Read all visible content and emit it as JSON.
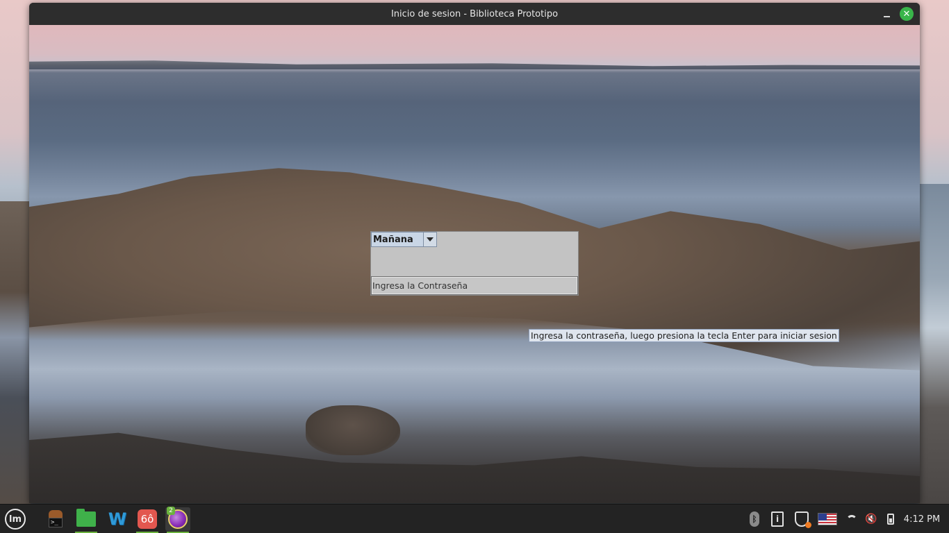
{
  "window": {
    "title": "Inicio de sesion - Biblioteca Prototipo",
    "minimize_symbol": "–",
    "close_symbol": "✕"
  },
  "login": {
    "shift_selected": "Mañana",
    "password_placeholder": "Ingresa la Contraseña",
    "tooltip": "Ingresa la contraseña, luego presiona la tecla Enter para iniciar sesion"
  },
  "taskbar": {
    "menu_logo": "lm",
    "apps": [
      {
        "name": "terminal-app",
        "icon": "terminal-icon",
        "prompt": ">_"
      },
      {
        "name": "files-app",
        "icon": "folder-icon"
      },
      {
        "name": "w-app",
        "icon": "w-logo-icon",
        "glyph": "W"
      },
      {
        "name": "glasses-app",
        "icon": "glasses-icon",
        "glyph": "6ô"
      },
      {
        "name": "eclipse-app",
        "icon": "eclipse-icon",
        "badge": "2"
      }
    ],
    "tray": {
      "bluetooth_glyph": "ᛒ",
      "clipboard_glyph": "i",
      "volume_glyph": "🔇",
      "clock": "4:12 PM"
    }
  },
  "colors": {
    "accent_green": "#6bb33e",
    "close_green": "#39b54a",
    "form_bg": "#c3c3c3",
    "combo_bg": "#c9d6e6",
    "tooltip_bg": "#dfe5ee"
  }
}
